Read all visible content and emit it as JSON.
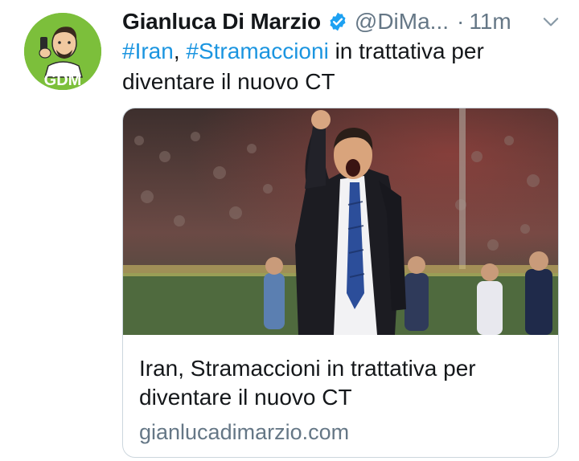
{
  "tweet": {
    "author_name": "Gianluca Di Marzio",
    "author_handle": "@DiMa...",
    "separator": "·",
    "timestamp": "11m",
    "avatar_logo_text": "GDM",
    "text_parts": {
      "hashtag_1": "#Iran",
      "comma": ", ",
      "hashtag_2": "#Stramaccioni",
      "rest": " in trattativa per diventare il nuovo CT"
    },
    "card": {
      "title": "Iran, Stramaccioni in trattativa per diventare il nuovo CT",
      "domain": "gianlucadimarzio.com"
    }
  },
  "colors": {
    "link": "#1b95e0",
    "secondary_text": "#657786",
    "avatar_bg": "#7cbf3b",
    "verified": "#1da1f2"
  },
  "icons": {
    "verified": "verified-badge-icon",
    "menu": "chevron-down-icon"
  }
}
